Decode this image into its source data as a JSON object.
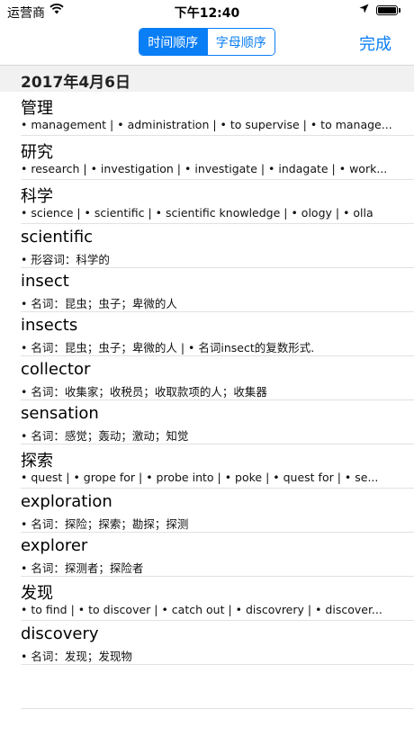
{
  "status_bar": {
    "carrier": "运营商",
    "wifi_icon": "wifi-icon",
    "time": "下午12:40",
    "location_icon": "location-arrow-icon",
    "battery_icon": "battery-icon"
  },
  "nav_bar": {
    "segments": [
      {
        "label": "时间顺序",
        "selected": true
      },
      {
        "label": "字母顺序",
        "selected": false
      }
    ],
    "done_label": "完成",
    "accent_color": "#0a7ef5"
  },
  "section": {
    "title": "2017年4月6日"
  },
  "entries": [
    {
      "word": "管理",
      "definitions": "• management  | • administration  | • to supervise  | • to manage..."
    },
    {
      "word": "研究",
      "definitions": "• research  | • investigation  | • investigate  | • indagate  | • work..."
    },
    {
      "word": "科学",
      "definitions": "• science  | • scientific  | • scientific knowledge  | • ology  | • olla"
    },
    {
      "word": "scientific",
      "definitions": "• 形容词：科学的"
    },
    {
      "word": "insect",
      "definitions": "• 名词：昆虫；虫子；卑微的人"
    },
    {
      "word": "insects",
      "definitions": "• 名词：昆虫；虫子；卑微的人  | • 名词insect的复数形式."
    },
    {
      "word": "collector",
      "definitions": "• 名词：收集家；收税员；收取款项的人；收集器"
    },
    {
      "word": "sensation",
      "definitions": "• 名词：感觉；轰动；激动；知觉"
    },
    {
      "word": "探索",
      "definitions": "• quest  | • grope for  | • probe into  | • poke  | • quest for  | • se..."
    },
    {
      "word": "exploration",
      "definitions": "• 名词：探险；探索；勘探；探测"
    },
    {
      "word": "explorer",
      "definitions": "• 名词：探测者；探险者"
    },
    {
      "word": "发现",
      "definitions": "• to find  | • to discover  | • catch out  | • discovrery  | • discover..."
    },
    {
      "word": "discovery",
      "definitions": "• 名词：发现；发现物"
    }
  ]
}
